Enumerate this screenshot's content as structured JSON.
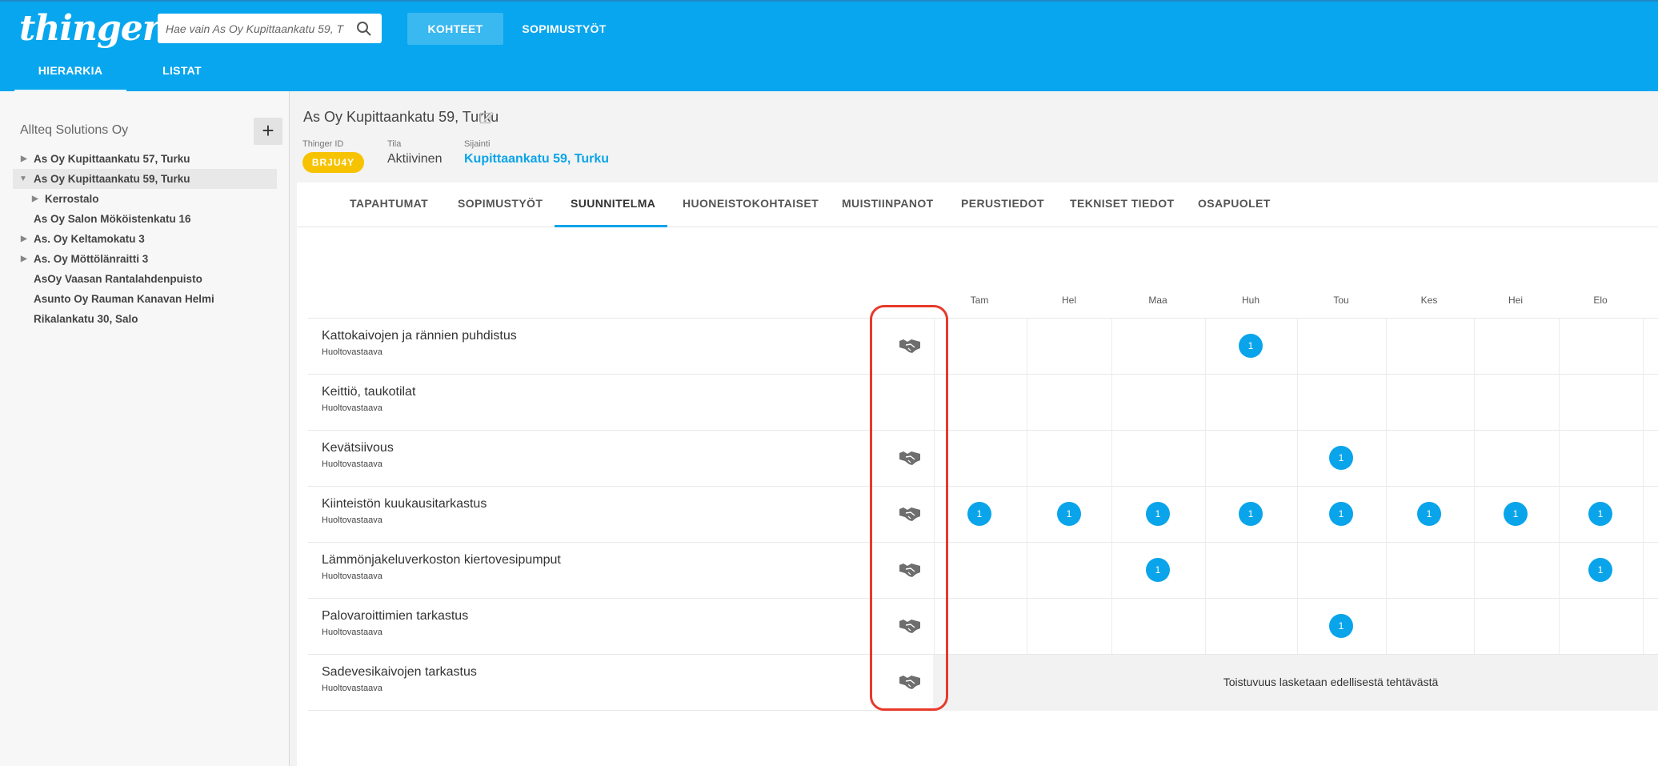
{
  "app": {
    "logo": "thinger",
    "search": {
      "placeholder": "Hae vain As Oy Kupittaankatu 59, T"
    },
    "nav": [
      "KOHTEET",
      "SOPIMUSTYÖT"
    ],
    "subnav": [
      "HIERARKIA",
      "LISTAT"
    ]
  },
  "sidebar": {
    "org": "Allteq Solutions Oy",
    "add_label": "+",
    "items": [
      {
        "label": "As Oy Kupittaankatu 57, Turku"
      },
      {
        "label": "As Oy Kupittaankatu 59, Turku"
      },
      {
        "label": "Kerrostalo"
      },
      {
        "label": "As Oy Salon Mököistenkatu 16"
      },
      {
        "label": "As. Oy Keltamokatu 3"
      },
      {
        "label": "As. Oy Möttölänraitti 3"
      },
      {
        "label": "AsOy Vaasan Rantalahdenpuisto"
      },
      {
        "label": "Asunto Oy Rauman Kanavan Helmi"
      },
      {
        "label": "Rikalankatu 30, Salo"
      }
    ]
  },
  "property": {
    "title": "As Oy Kupittaankatu 59, Turku",
    "thinger_id_label": "Thinger ID",
    "thinger_id": "BRJU4Y",
    "status_label": "Tila",
    "status": "Aktiivinen",
    "location_label": "Sijainti",
    "location": "Kupittaankatu 59, Turku"
  },
  "tabs": [
    "TAPAHTUMAT",
    "SOPIMUSTYÖT",
    "SUUNNITELMA",
    "HUONEISTOKOHTAISET",
    "MUISTIINPANOT",
    "PERUSTIEDOT",
    "TEKNISET TIEDOT",
    "OSAPUOLET"
  ],
  "active_tab": "SUUNNITELMA",
  "months": [
    "Tam",
    "Hel",
    "Maa",
    "Huh",
    "Tou",
    "Kes",
    "Hei",
    "Elo"
  ],
  "tasks": [
    {
      "name": "Kattokaivojen ja rännien puhdistus",
      "role": "Huoltovastaava",
      "contract": true,
      "counts": [
        "",
        "",
        "",
        "1",
        "",
        "",
        "",
        ""
      ]
    },
    {
      "name": "Keittiö, taukotilat",
      "role": "Huoltovastaava",
      "contract": false,
      "counts": [
        "",
        "",
        "",
        "",
        "",
        "",
        "",
        ""
      ]
    },
    {
      "name": "Kevätsiivous",
      "role": "Huoltovastaava",
      "contract": true,
      "counts": [
        "",
        "",
        "",
        "",
        "1",
        "",
        "",
        ""
      ]
    },
    {
      "name": "Kiinteistön kuukausitarkastus",
      "role": "Huoltovastaava",
      "contract": true,
      "counts": [
        "1",
        "1",
        "1",
        "1",
        "1",
        "1",
        "1",
        "1"
      ]
    },
    {
      "name": "Lämmönjakeluverkoston kiertovesipumput",
      "role": "Huoltovastaava",
      "contract": true,
      "counts": [
        "",
        "",
        "1",
        "",
        "",
        "",
        "",
        "1"
      ]
    },
    {
      "name": "Palovaroittimien tarkastus",
      "role": "Huoltovastaava",
      "contract": true,
      "counts": [
        "",
        "",
        "",
        "",
        "1",
        "",
        "",
        ""
      ]
    },
    {
      "name": "Sadevesikaivojen tarkastus",
      "role": "Huoltovastaava",
      "contract": true,
      "counts": []
    }
  ],
  "recurrence_note": "Toistuvuus lasketaan edellisestä tehtävästä",
  "colors": {
    "brand": "#08a6ee",
    "accent": "#0aa4ea",
    "badge": "#f7c300",
    "highlight": "#e8392b"
  },
  "icons": [
    "search-icon",
    "edit-icon",
    "handshake-icon",
    "expand-arrow-icon"
  ]
}
